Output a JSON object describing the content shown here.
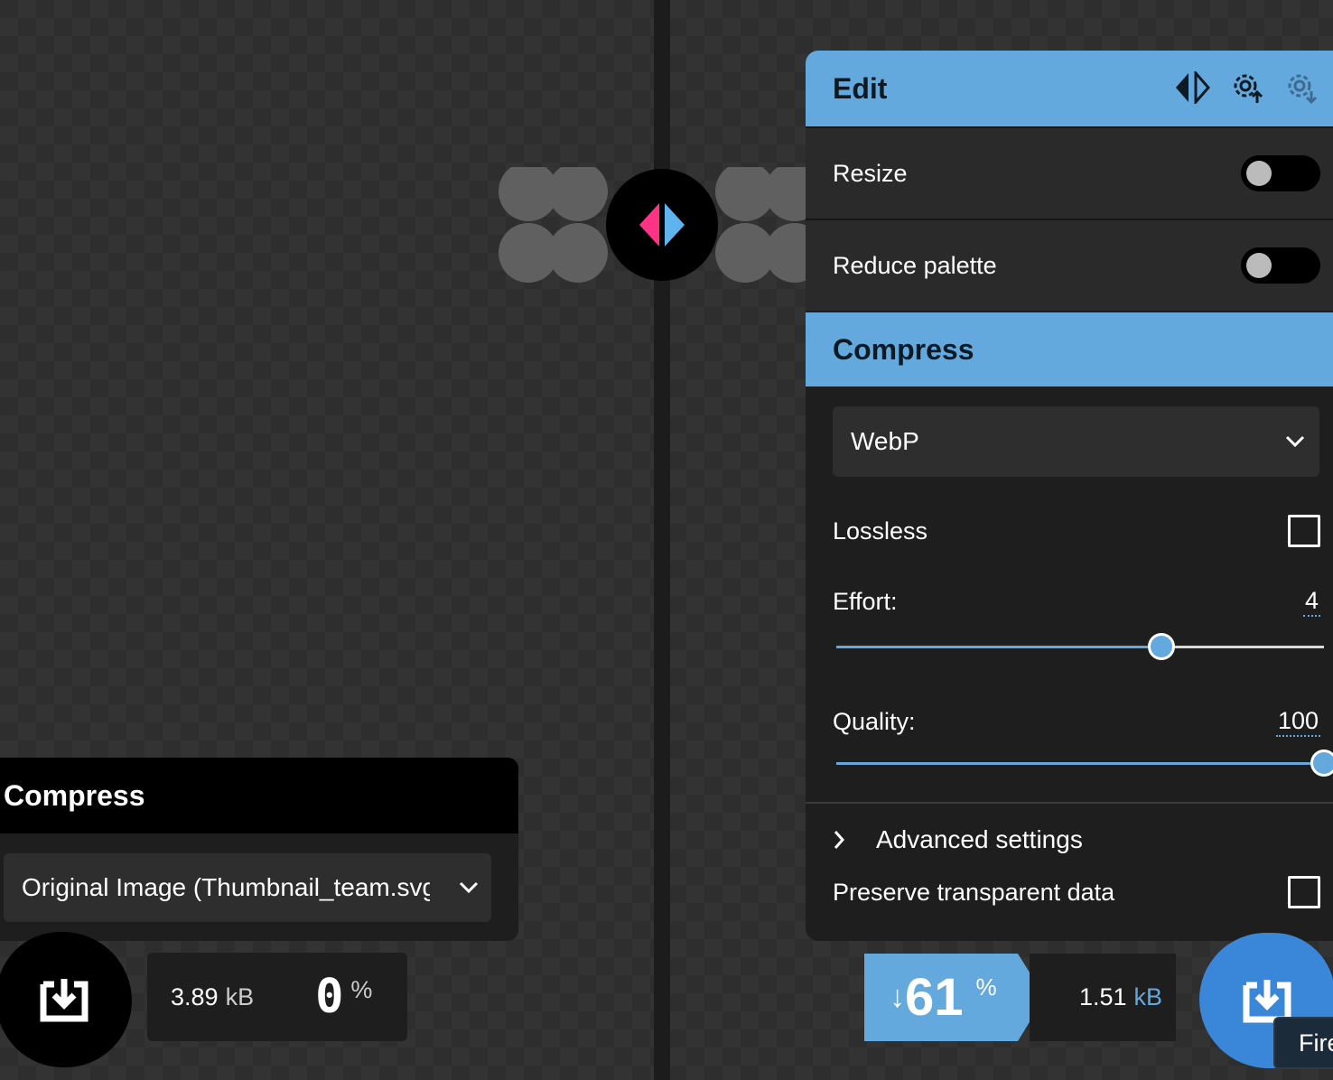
{
  "edit_panel": {
    "title": "Edit",
    "icons": [
      "split-view-icon",
      "import-settings-icon",
      "export-settings-icon"
    ],
    "resize_label": "Resize",
    "resize_on": false,
    "reduce_palette_label": "Reduce palette",
    "reduce_palette_on": false
  },
  "compress_panel": {
    "title": "Compress",
    "format": "WebP",
    "lossless_label": "Lossless",
    "lossless_checked": false,
    "effort_label": "Effort:",
    "effort_value": "4",
    "effort_min": 0,
    "effort_max": 6,
    "quality_label": "Quality:",
    "quality_value": "100",
    "quality_min": 0,
    "quality_max": 100,
    "advanced_label": "Advanced settings",
    "preserve_label": "Preserve transparent data",
    "preserve_checked": false
  },
  "left_panel": {
    "title": "Compress",
    "selected": "Original Image (Thumbnail_team.svg)"
  },
  "left_result": {
    "size": "3.89",
    "unit": "kB",
    "percent": "0",
    "percent_sign": "%"
  },
  "right_result": {
    "arrow": "↓",
    "percent": "61",
    "percent_sign": "%",
    "size": "1.51",
    "unit": "kB"
  },
  "tooltip": {
    "text": "Fire"
  },
  "colors": {
    "accent": "#64a9dd",
    "pink": "#ff3385",
    "download_blue": "#3a87d9"
  }
}
